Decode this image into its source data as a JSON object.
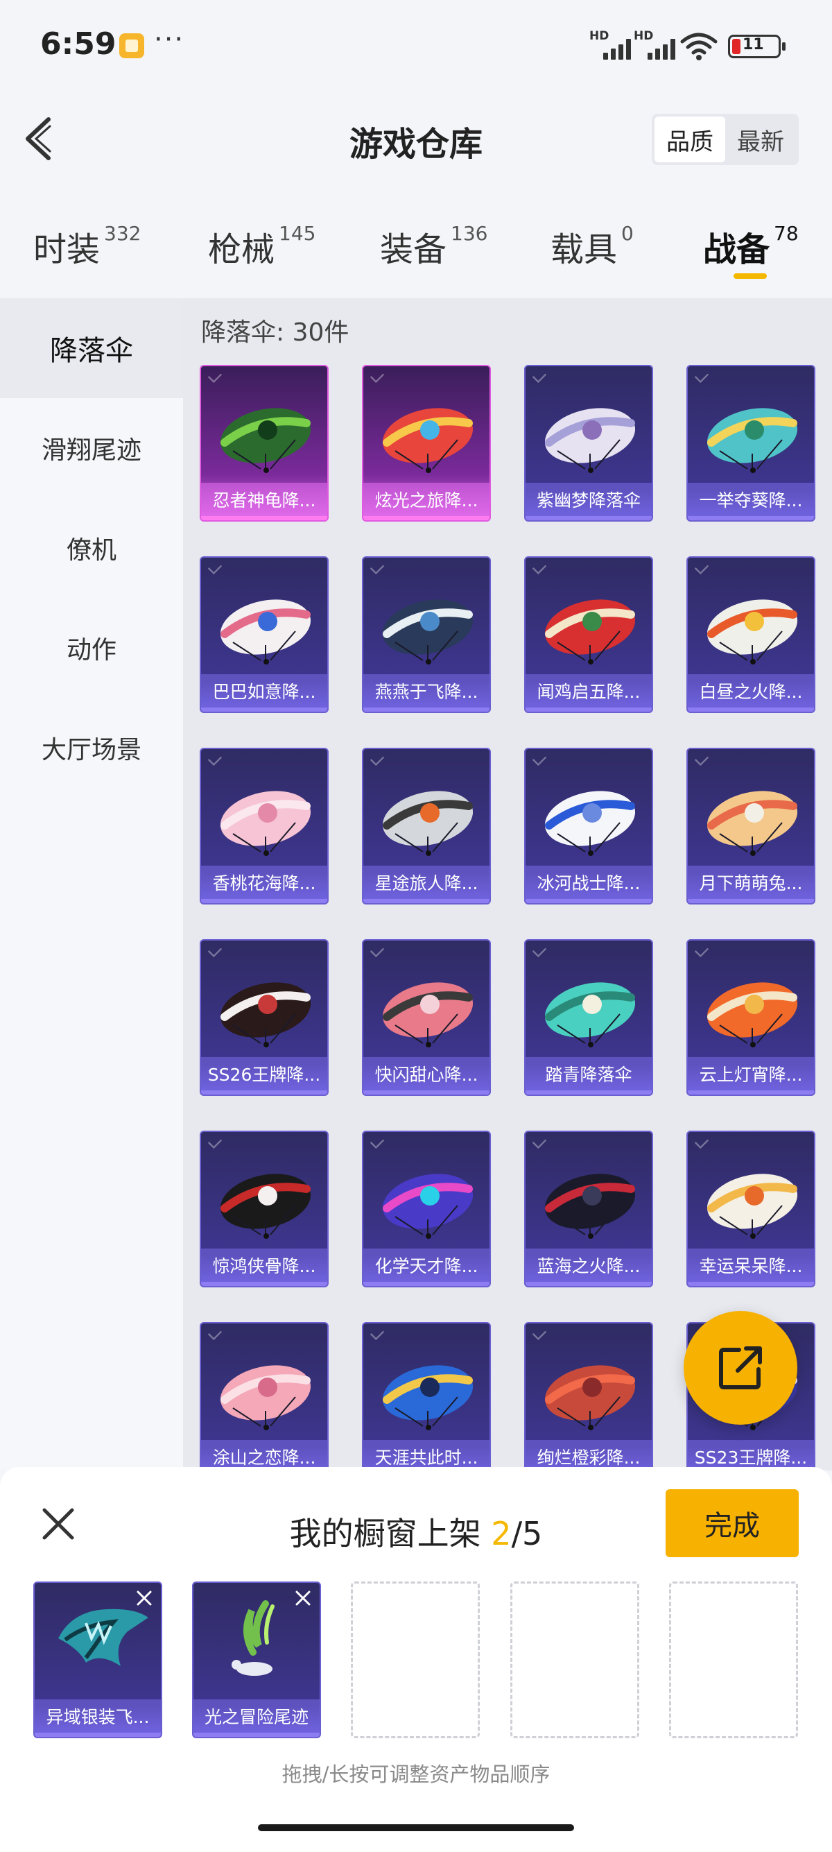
{
  "status_bar": {
    "time": "6:59",
    "signal1_hd": "HD",
    "signal2_hd": "HD",
    "battery": "11",
    "more": "···"
  },
  "header": {
    "title": "游戏仓库",
    "sort_options": [
      "品质",
      "最新"
    ],
    "sort_selected": "品质"
  },
  "tabs": [
    {
      "label": "时装",
      "count": "332"
    },
    {
      "label": "枪械",
      "count": "145"
    },
    {
      "label": "装备",
      "count": "136"
    },
    {
      "label": "载具",
      "count": "0"
    },
    {
      "label": "战备",
      "count": "78",
      "active": true
    }
  ],
  "sidebar": {
    "items": [
      {
        "label": "降落伞",
        "active": true
      },
      {
        "label": "滑翔尾迹"
      },
      {
        "label": "僚机"
      },
      {
        "label": "动作"
      },
      {
        "label": "大厅场景"
      }
    ]
  },
  "content": {
    "count_label": "降落伞: 30件",
    "items": [
      {
        "name": "忍者神龟降...",
        "rarity": "pink",
        "colors": [
          "#2c6b2e",
          "#7bd04a",
          "#123d1a"
        ]
      },
      {
        "name": "炫光之旅降...",
        "rarity": "pink",
        "colors": [
          "#e8453c",
          "#f7c84a",
          "#45b5e8"
        ]
      },
      {
        "name": "紫幽梦降落伞",
        "rarity": "purple",
        "colors": [
          "#e6e2f2",
          "#a6a0d8",
          "#8b6fb8"
        ]
      },
      {
        "name": "一举夺葵降...",
        "rarity": "purple",
        "colors": [
          "#4fc3c8",
          "#f2d45a",
          "#2a8c6a"
        ]
      },
      {
        "name": "巴巴如意降...",
        "rarity": "purple",
        "colors": [
          "#f4f0f2",
          "#e46a8a",
          "#3a6ad8"
        ]
      },
      {
        "name": "燕燕于飞降...",
        "rarity": "purple",
        "colors": [
          "#2a3a5a",
          "#e8f0f4",
          "#4a8ac8"
        ]
      },
      {
        "name": "闻鸡启五降...",
        "rarity": "purple",
        "colors": [
          "#d83030",
          "#f4e6c8",
          "#3a8a4a"
        ]
      },
      {
        "name": "白昼之火降...",
        "rarity": "purple",
        "colors": [
          "#f0f0ea",
          "#e85a2a",
          "#f2c03a"
        ]
      },
      {
        "name": "香桃花海降...",
        "rarity": "purple",
        "colors": [
          "#f6c4d4",
          "#fbe8ee",
          "#e48aa8"
        ]
      },
      {
        "name": "星途旅人降...",
        "rarity": "purple",
        "colors": [
          "#d4d8dc",
          "#3a3a3a",
          "#e86a2a"
        ]
      },
      {
        "name": "冰河战士降...",
        "rarity": "purple",
        "colors": [
          "#f4f6fa",
          "#2a5ad8",
          "#6a8ae0"
        ]
      },
      {
        "name": "月下萌萌兔...",
        "rarity": "purple",
        "colors": [
          "#f4c88a",
          "#e86a4a",
          "#f2f0e6"
        ]
      },
      {
        "name": "SS26王牌降...",
        "rarity": "purple",
        "colors": [
          "#2a1a1a",
          "#f4f0f0",
          "#c83a3a"
        ]
      },
      {
        "name": "快闪甜心降...",
        "rarity": "purple",
        "colors": [
          "#e87a8a",
          "#3a3a3a",
          "#f4d0d8"
        ]
      },
      {
        "name": "踏青降落伞",
        "rarity": "purple",
        "colors": [
          "#4ad0c0",
          "#2a8a7a",
          "#f4f0e0"
        ]
      },
      {
        "name": "云上灯宵降...",
        "rarity": "purple",
        "colors": [
          "#f26a2a",
          "#f4e6c8",
          "#f2b84a"
        ]
      },
      {
        "name": "惊鸿侠骨降...",
        "rarity": "purple",
        "colors": [
          "#1a1a1a",
          "#c82a2a",
          "#f4f0f0"
        ]
      },
      {
        "name": "化学天才降...",
        "rarity": "purple",
        "colors": [
          "#4a3ac8",
          "#e84ac8",
          "#2ad0e8"
        ]
      },
      {
        "name": "蓝海之火降...",
        "rarity": "purple",
        "colors": [
          "#1a1a2a",
          "#c82a3a",
          "#3a3a5a"
        ]
      },
      {
        "name": "幸运呆呆降...",
        "rarity": "purple",
        "colors": [
          "#f4f0e6",
          "#f2b84a",
          "#e86a2a"
        ]
      },
      {
        "name": "涂山之恋降...",
        "rarity": "purple",
        "colors": [
          "#f4a8b8",
          "#fbe0e6",
          "#d86a8a"
        ]
      },
      {
        "name": "天涯共此时...",
        "rarity": "purple",
        "colors": [
          "#2a6ad8",
          "#f2c84a",
          "#1a2a5a"
        ]
      },
      {
        "name": "绚烂橙彩降...",
        "rarity": "purple",
        "colors": [
          "#c84a3a",
          "#f26a4a",
          "#8a2a2a"
        ]
      },
      {
        "name": "SS23王牌降...",
        "rarity": "purple",
        "colors": [
          "#3a3aa8",
          "#f4f0f0",
          "#2a2a6a"
        ]
      }
    ]
  },
  "fab": {
    "icon": "share-icon"
  },
  "sheet": {
    "title_prefix": "我的橱窗上架 ",
    "current": "2",
    "total": "/5",
    "done_label": "完成",
    "slots": [
      {
        "name": "异域银装飞...",
        "filled": true
      },
      {
        "name": "光之冒险尾迹",
        "filled": true
      },
      {
        "filled": false
      },
      {
        "filled": false
      },
      {
        "filled": false
      }
    ],
    "hint": "拖拽/长按可调整资产物品顺序"
  }
}
